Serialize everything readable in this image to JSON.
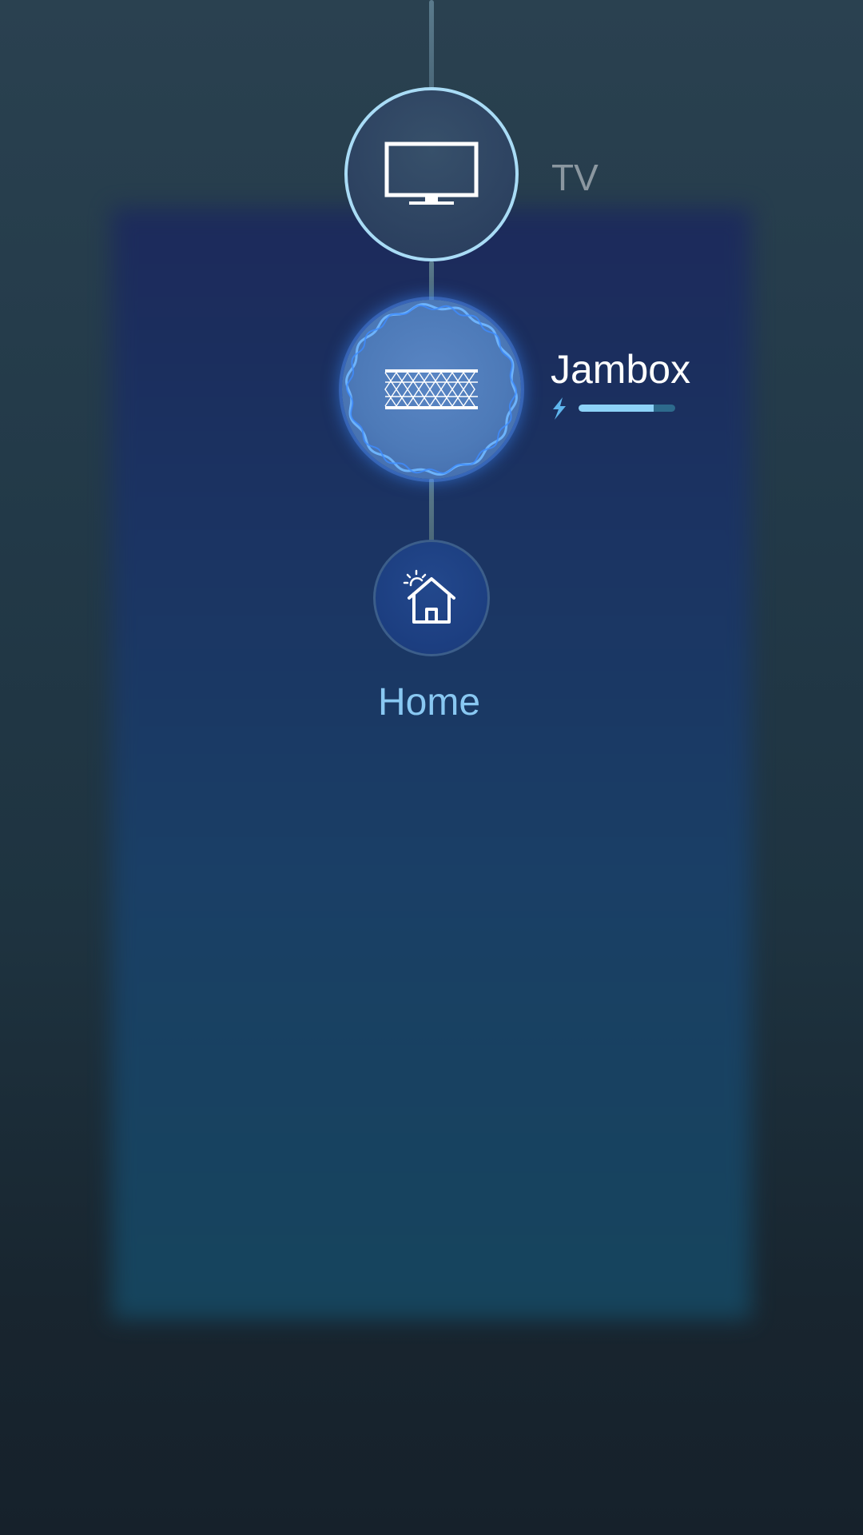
{
  "devices": [
    {
      "name": "TV",
      "icon": "tv-icon",
      "state": "connected"
    },
    {
      "name": "Jambox",
      "icon": "speaker-icon",
      "state": "active",
      "battery": {
        "icon": "bolt-icon",
        "level_percent": 78
      }
    }
  ],
  "home": {
    "label": "Home",
    "icon": "home-icon"
  },
  "colors": {
    "accent": "#8dd2f8",
    "tv_ring": "#a9dcf6",
    "active_glow": "#3c8cff",
    "home_label": "#89c8f2",
    "inactive_label": "#8b97a0"
  }
}
